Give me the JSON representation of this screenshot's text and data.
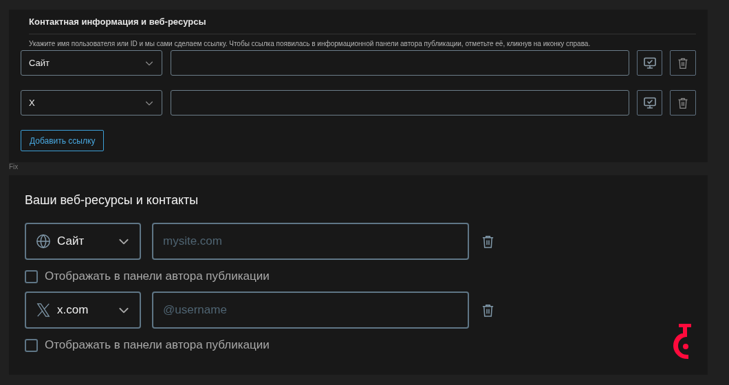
{
  "old_form": {
    "title": "Контактная информация и веб-ресурсы",
    "hint": "Укажите имя пользователя или ID и мы сами сделаем ссылку. Чтобы ссылка появилась в информационной панели автора публикации, отметьте её, кликнув на иконку справа.",
    "links": [
      {
        "type": "Сайт"
      },
      {
        "type": "X"
      }
    ],
    "add_button": "Добавить ссылку"
  },
  "caption": "Fix",
  "new_form": {
    "title": "Ваши веб-ресурсы и контакты",
    "links": [
      {
        "kind": "globe",
        "type": "Сайт",
        "placeholder": "mysite.com",
        "show_label": "Отображать в панели автора публикации",
        "checked": false
      },
      {
        "kind": "x",
        "type": "x.com",
        "placeholder": "@username",
        "show_label": "Отображать в панели автора публикации",
        "checked": false
      }
    ]
  }
}
